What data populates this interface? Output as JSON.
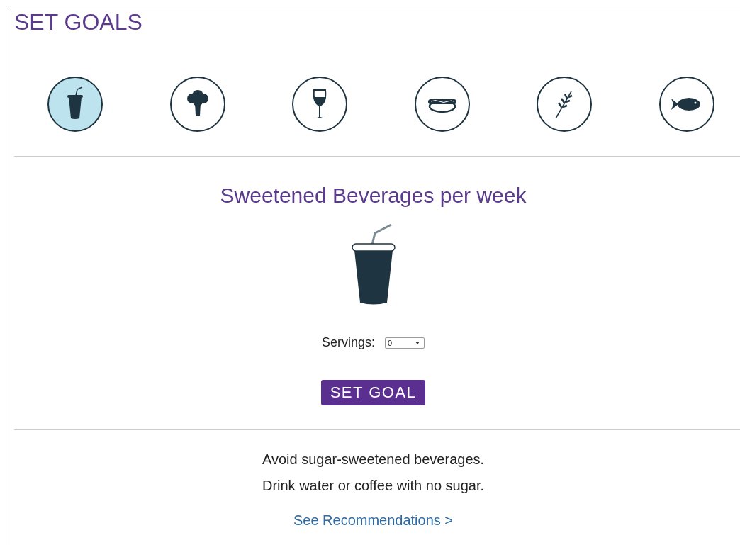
{
  "title": "SET GOALS",
  "categories": [
    {
      "kind": "beverage",
      "selected": true
    },
    {
      "kind": "broccoli",
      "selected": false
    },
    {
      "kind": "wine",
      "selected": false
    },
    {
      "kind": "hotdog",
      "selected": false
    },
    {
      "kind": "grain",
      "selected": false
    },
    {
      "kind": "fish",
      "selected": false
    }
  ],
  "goal": {
    "heading": "Sweetened Beverages per week",
    "servings_label": "Servings:",
    "servings_value": "0",
    "button": "SET GOAL"
  },
  "advice": [
    "Avoid sugar-sweetened beverages.",
    "Drink water or coffee with no sugar."
  ],
  "link": "See Recommendations >"
}
